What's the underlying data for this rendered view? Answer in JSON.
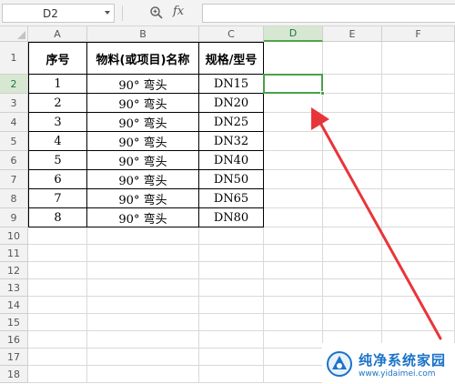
{
  "formula_bar": {
    "namebox": "D2",
    "zoom_icon": "zoom-icon",
    "fx_label": "fx",
    "formula": ""
  },
  "columns": [
    "A",
    "B",
    "C",
    "D",
    "E",
    "F"
  ],
  "rows": [
    "1",
    "2",
    "3",
    "4",
    "5",
    "6",
    "7",
    "8",
    "9",
    "10",
    "11",
    "12",
    "13",
    "14",
    "15",
    "16",
    "17",
    "18"
  ],
  "selected": {
    "column": "D",
    "row": "2"
  },
  "table": {
    "headers": [
      "序号",
      "物料(或项目)名称",
      "规格/型号"
    ],
    "rows": [
      [
        "1",
        "90° 弯头",
        "DN15"
      ],
      [
        "2",
        "90° 弯头",
        "DN20"
      ],
      [
        "3",
        "90° 弯头",
        "DN25"
      ],
      [
        "4",
        "90° 弯头",
        "DN32"
      ],
      [
        "5",
        "90° 弯头",
        "DN40"
      ],
      [
        "6",
        "90° 弯头",
        "DN50"
      ],
      [
        "7",
        "90° 弯头",
        "DN65"
      ],
      [
        "8",
        "90° 弯头",
        "DN80"
      ]
    ]
  },
  "colors": {
    "arrow": "#e8353a",
    "selection": "#4aa14a",
    "watermark": "#1a73c8"
  },
  "watermark": {
    "logo_icon": "site-logo-icon",
    "title": "纯净系统家园",
    "url": "www.yidaimei.com"
  }
}
